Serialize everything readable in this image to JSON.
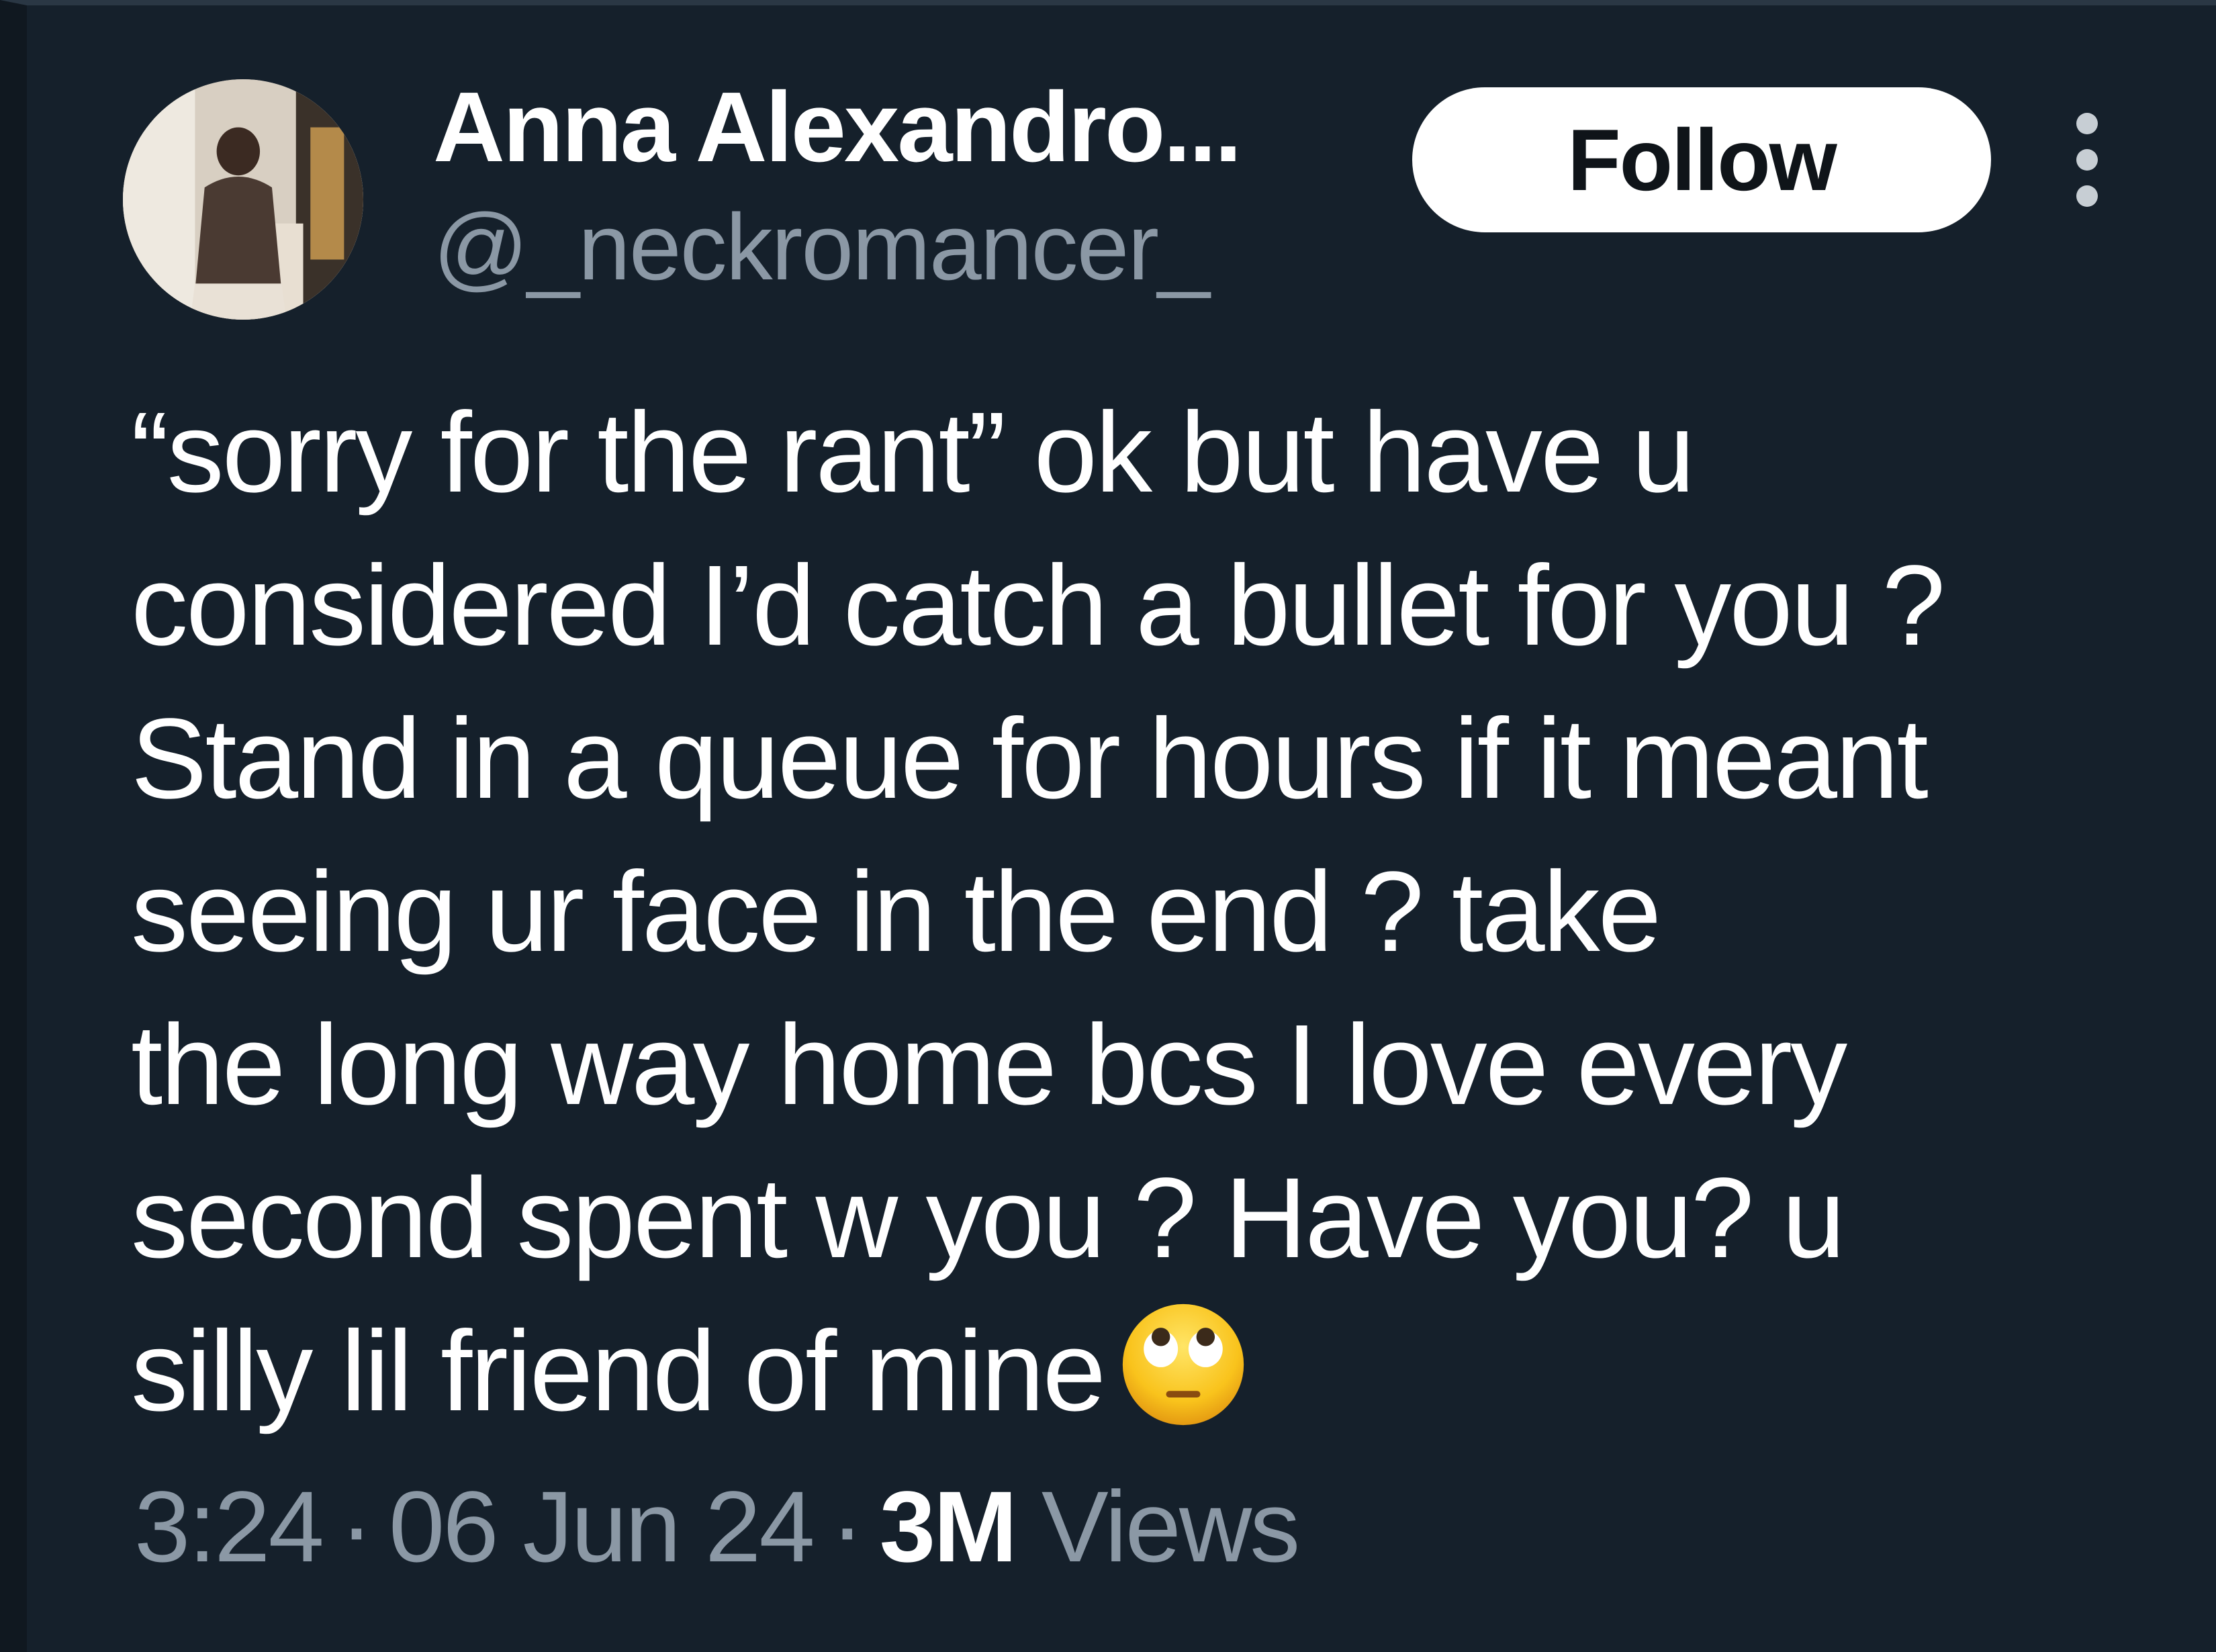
{
  "author": {
    "display_name": "Anna Alexandro...",
    "handle": "@_neckromancer_",
    "avatar_icon": "profile-photo"
  },
  "follow_button": {
    "label": "Follow"
  },
  "more_button": {
    "icon": "more-vertical-icon"
  },
  "tweet": {
    "text": "“sorry for the rant” ok but have u\nconsidered I’d catch a bullet for you ?\nStand in a queue for hours if it meant\nseeing ur face in the end ? take\nthe long way home bcs I love every\nsecond spent w you ? Have you? u\nsilly lil friend of mine",
    "emoji": "face-with-rolling-eyes"
  },
  "meta": {
    "time": "3:24",
    "date": "06 Jun 24",
    "separator": "·",
    "views_count": "3M",
    "views_label": "Views"
  },
  "colors": {
    "background": "#15202b",
    "text_primary": "#ffffff",
    "text_secondary": "#8b98a5",
    "button_bg": "#ffffff",
    "button_text": "#0f1419"
  }
}
